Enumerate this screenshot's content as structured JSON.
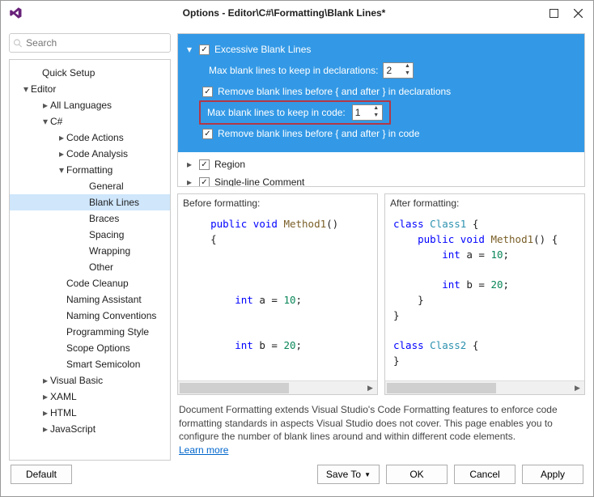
{
  "window": {
    "title": "Options - Editor\\C#\\Formatting\\Blank Lines*"
  },
  "search": {
    "placeholder": "Search"
  },
  "tree": [
    {
      "label": "Quick Setup",
      "indent": 28,
      "tw": ""
    },
    {
      "label": "Editor",
      "indent": 14,
      "tw": "▾"
    },
    {
      "label": "All Languages",
      "indent": 38,
      "tw": "▸"
    },
    {
      "label": "C#",
      "indent": 38,
      "tw": "▾"
    },
    {
      "label": "Code Actions",
      "indent": 58,
      "tw": "▸"
    },
    {
      "label": "Code Analysis",
      "indent": 58,
      "tw": "▸"
    },
    {
      "label": "Formatting",
      "indent": 58,
      "tw": "▾"
    },
    {
      "label": "General",
      "indent": 86,
      "tw": ""
    },
    {
      "label": "Blank Lines",
      "indent": 86,
      "tw": "",
      "selected": true
    },
    {
      "label": "Braces",
      "indent": 86,
      "tw": ""
    },
    {
      "label": "Spacing",
      "indent": 86,
      "tw": ""
    },
    {
      "label": "Wrapping",
      "indent": 86,
      "tw": ""
    },
    {
      "label": "Other",
      "indent": 86,
      "tw": ""
    },
    {
      "label": "Code Cleanup",
      "indent": 58,
      "tw": ""
    },
    {
      "label": "Naming Assistant",
      "indent": 58,
      "tw": ""
    },
    {
      "label": "Naming Conventions",
      "indent": 58,
      "tw": ""
    },
    {
      "label": "Programming Style",
      "indent": 58,
      "tw": ""
    },
    {
      "label": "Scope Options",
      "indent": 58,
      "tw": ""
    },
    {
      "label": "Smart Semicolon",
      "indent": 58,
      "tw": ""
    },
    {
      "label": "Visual Basic",
      "indent": 38,
      "tw": "▸"
    },
    {
      "label": "XAML",
      "indent": 38,
      "tw": "▸"
    },
    {
      "label": "HTML",
      "indent": 38,
      "tw": "▸"
    },
    {
      "label": "JavaScript",
      "indent": 38,
      "tw": "▸"
    }
  ],
  "opts": {
    "group_title": "Excessive Blank Lines",
    "max_decl_label": "Max blank lines to keep in declarations:",
    "max_decl_value": "2",
    "remove_decl": "Remove blank lines before { and after } in declarations",
    "max_code_label": "Max blank lines to keep in code:",
    "max_code_value": "1",
    "remove_code": "Remove blank lines before { and after } in code",
    "region": "Region",
    "single_comment": "Single-line Comment"
  },
  "before": {
    "title": "Before formatting:"
  },
  "after": {
    "title": "After formatting:"
  },
  "desc": {
    "text": "Document Formatting extends Visual Studio's Code Formatting features to enforce code formatting standards in aspects Visual Studio does not cover. This page enables you to configure the number of blank lines around and within different code elements.",
    "link": "Learn more"
  },
  "buttons": {
    "default": "Default",
    "saveto": "Save To",
    "ok": "OK",
    "cancel": "Cancel",
    "apply": "Apply"
  }
}
